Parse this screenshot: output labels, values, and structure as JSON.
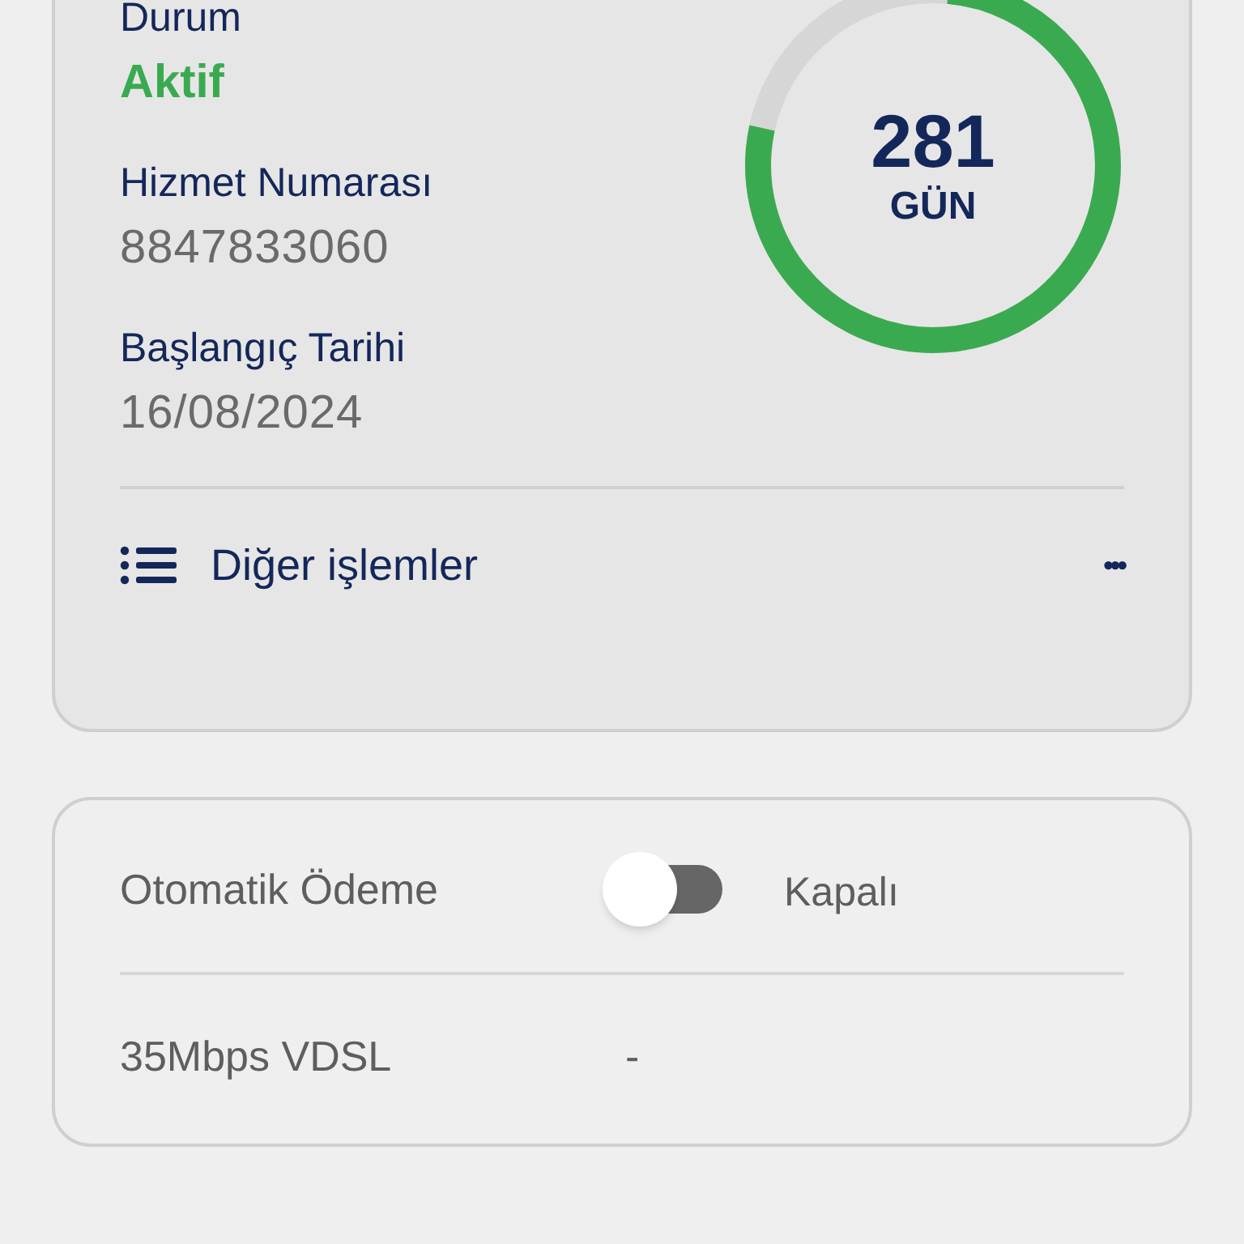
{
  "service_card": {
    "fields": [
      {
        "label": "Durum",
        "value": "Aktif",
        "kind": "status"
      },
      {
        "label": "Hizmet Numarası",
        "value": "8847833060",
        "kind": "plain"
      },
      {
        "label": "Başlangıç Tarihi",
        "value": "16/08/2024",
        "kind": "plain"
      }
    ],
    "days_ring": {
      "value": "281",
      "unit": "GÜN",
      "level": 0.77
    },
    "more_actions": {
      "label": "Diğer işlemler",
      "menu": "•••"
    }
  },
  "settings_card": {
    "rows": [
      {
        "kind": "toggle",
        "label": "Otomatik Ödeme",
        "on": false,
        "state_label": "Kapalı"
      },
      {
        "kind": "text",
        "label": "35Mbps VDSL",
        "value": "-"
      }
    ]
  }
}
